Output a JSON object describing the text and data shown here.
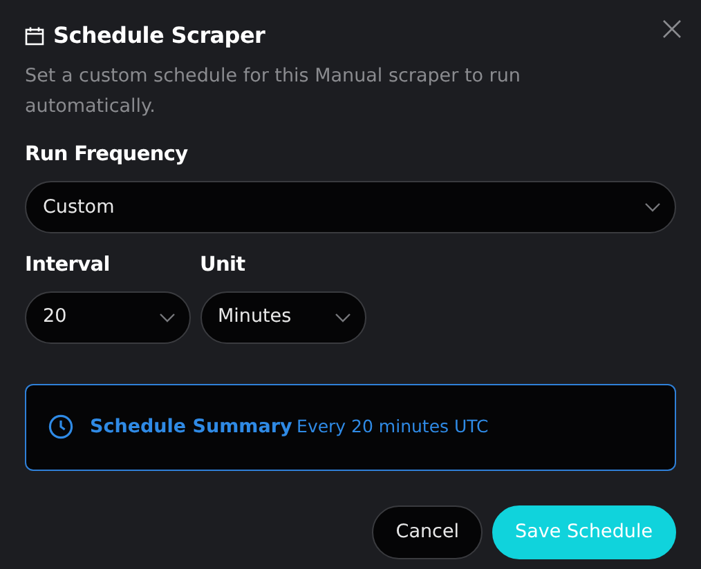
{
  "dialog": {
    "title": "Schedule Scraper",
    "description": "Set a custom schedule for this Manual scraper to run automatically."
  },
  "fields": [
    {
      "label": "Run Frequency",
      "value": "Custom",
      "kind": "wide"
    },
    {
      "label": "Interval",
      "value": "20",
      "kind": "narrow"
    },
    {
      "label": "Unit",
      "value": "Minutes",
      "kind": "narrow"
    }
  ],
  "summary": {
    "heading": "Schedule Summary",
    "text": "Every 20 minutes UTC"
  },
  "buttons": [
    {
      "label": "Cancel",
      "kind": "secondary"
    },
    {
      "label": "Save Schedule",
      "kind": "primary"
    }
  ]
}
